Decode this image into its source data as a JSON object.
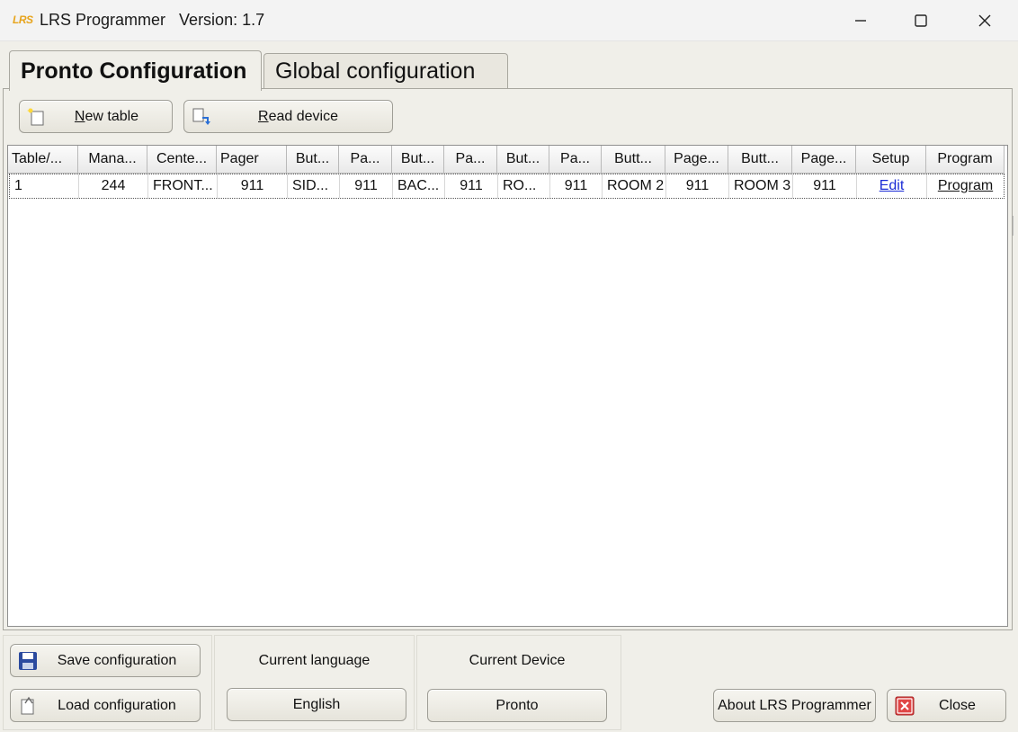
{
  "window": {
    "logo_text": "LRS",
    "title": "LRS Programmer   Version: 1.7"
  },
  "tabs": [
    {
      "label": "Pronto Configuration",
      "active": true
    },
    {
      "label": "Global configuration",
      "active": false
    }
  ],
  "toolbar": {
    "new_table_prefix": "N",
    "new_table_rest": "ew table",
    "read_device_prefix": "R",
    "read_device_rest": "ead device"
  },
  "grid": {
    "headers": [
      "Table/...",
      "Mana...",
      "Cente...",
      "Pager",
      "But...",
      "Pa...",
      "But...",
      "Pa...",
      "But...",
      "Pa...",
      "Butt...",
      "Page...",
      "Butt...",
      "Page...",
      "Setup",
      "Program"
    ],
    "rows": [
      [
        "1",
        "244",
        "FRONT...",
        "911",
        "SID...",
        "911",
        "BAC...",
        "911",
        "RO...",
        "911",
        "ROOM 2",
        "911",
        "ROOM 3",
        "911",
        "Edit",
        "Program"
      ]
    ]
  },
  "footer": {
    "save_label": "Save configuration",
    "load_label": "Load configuration",
    "language_label": "Current language",
    "language_value": "English",
    "device_label": "Current Device",
    "device_value": "Pronto",
    "about_label": "About LRS Programmer",
    "close_label": "Close"
  },
  "colors": {
    "accent_logo": "#e7a41c",
    "link": "#1a2bd6",
    "window_bg": "#f0efe9"
  }
}
